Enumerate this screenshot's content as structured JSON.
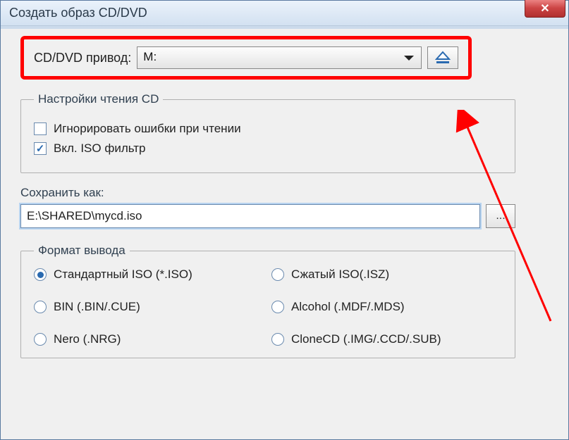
{
  "window": {
    "title": "Создать образ CD/DVD"
  },
  "drive": {
    "label": "CD/DVD привод:",
    "selected": "M:"
  },
  "read_settings": {
    "legend": "Настройки чтения CD",
    "ignore_errors": {
      "label": "Игнорировать ошибки при чтении",
      "checked": false
    },
    "iso_filter": {
      "label": "Вкл. ISO фильтр",
      "checked": true
    }
  },
  "save": {
    "label": "Сохранить как:",
    "value": "E:\\SHARED\\mycd.iso",
    "browse_label": "..."
  },
  "format": {
    "legend": "Формат вывода",
    "options": [
      {
        "label": "Стандартный ISO (*.ISO)",
        "selected": true
      },
      {
        "label": "Сжатый ISO(.ISZ)",
        "selected": false
      },
      {
        "label": "BIN (.BIN/.CUE)",
        "selected": false
      },
      {
        "label": "Alcohol (.MDF/.MDS)",
        "selected": false
      },
      {
        "label": "Nero (.NRG)",
        "selected": false
      },
      {
        "label": "CloneCD (.IMG/.CCD/.SUB)",
        "selected": false
      }
    ]
  },
  "icons": {
    "close": "✕"
  }
}
